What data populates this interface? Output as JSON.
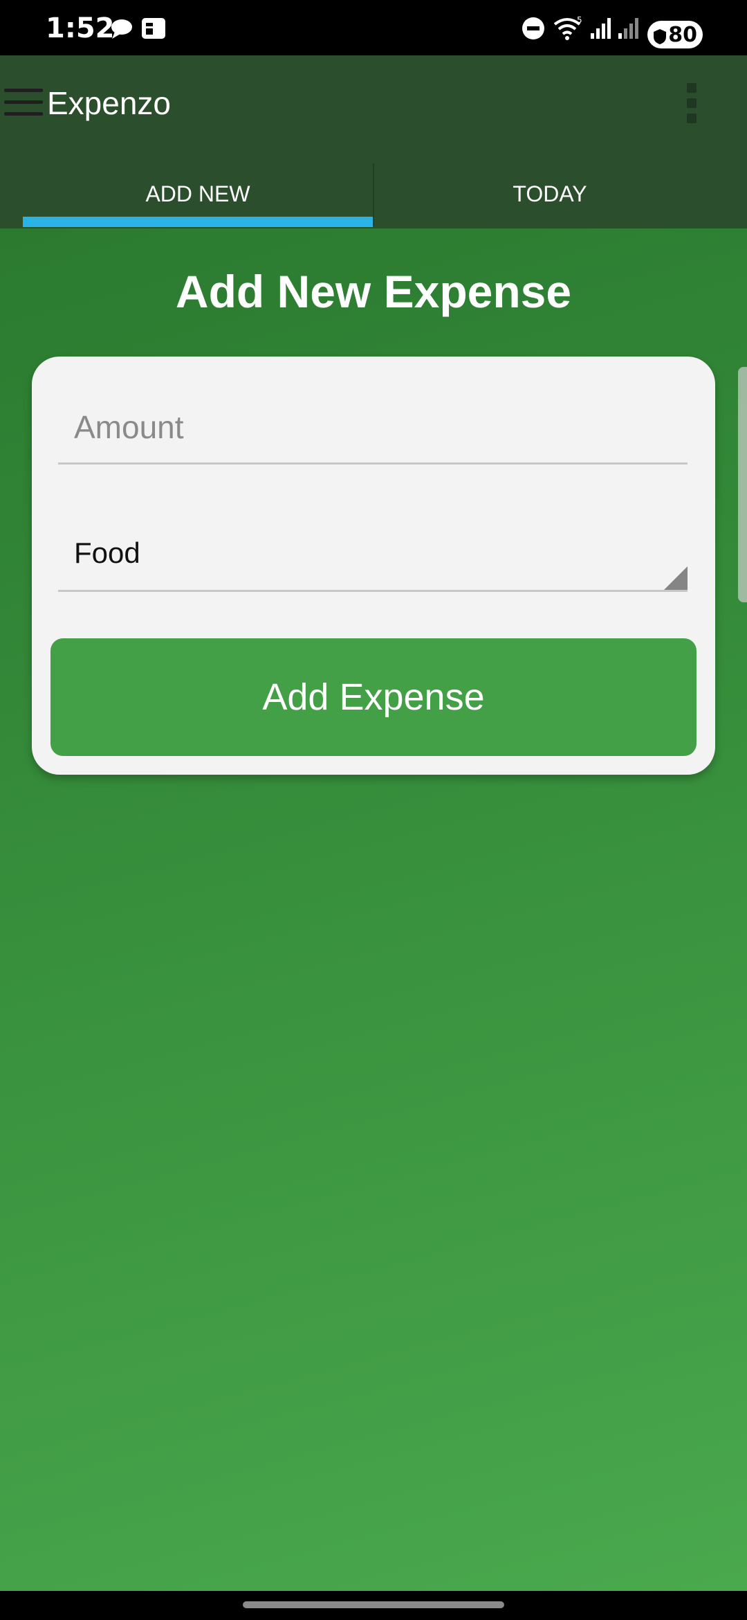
{
  "status_bar": {
    "time": "1:52",
    "battery": "80",
    "icons": [
      "chat-icon",
      "news-icon",
      "do-not-disturb-icon",
      "wifi-icon",
      "signal-icon",
      "signal-icon",
      "shield-icon"
    ]
  },
  "app_bar": {
    "title": "Expenzo",
    "color": "#2b4e2d"
  },
  "tabs": [
    {
      "label": "ADD NEW",
      "selected": true
    },
    {
      "label": "TODAY",
      "selected": false
    }
  ],
  "tab_indicator_color": "#2ab3e4",
  "page": {
    "title": "Add New Expense"
  },
  "form": {
    "amount_placeholder": "Amount",
    "category_value": "Food",
    "submit_label": "Add Expense"
  },
  "colors": {
    "button": "#44a047",
    "background_start": "#2b7a30",
    "background_end": "#4aa84d"
  }
}
